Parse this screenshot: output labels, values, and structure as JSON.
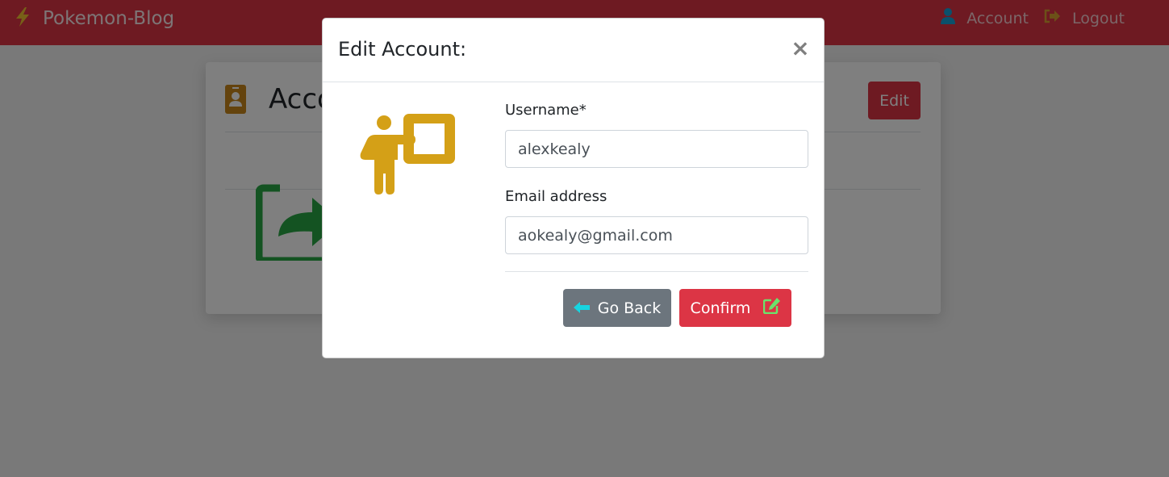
{
  "navbar": {
    "brand": "Pokemon-Blog",
    "account_label": "Account",
    "logout_label": "Logout"
  },
  "page": {
    "title": "Account",
    "edit_label": "Edit"
  },
  "modal": {
    "title": "Edit Account:",
    "close_label": "×",
    "username_label": "Username*",
    "username_value": "alexkealy",
    "email_label": "Email address",
    "email_value": "aokealy@gmail.com",
    "back_label": "Go Back",
    "confirm_label": "Confirm"
  },
  "colors": {
    "primary": "#dc3545",
    "secondary": "#6c757d",
    "icon_gold": "#d4a017",
    "icon_green": "#28a745",
    "icon_cyan": "#17d4e0",
    "icon_blue": "#17a2d8",
    "icon_yellow": "#f0c030"
  },
  "icons": {
    "brand": "bolt-icon",
    "account": "user-icon",
    "logout": "sign-out-icon",
    "card": "id-badge-icon",
    "card_main": "share-square-icon",
    "modal": "chalkboard-teacher-icon",
    "back": "arrow-left-icon",
    "confirm": "edit-icon"
  }
}
